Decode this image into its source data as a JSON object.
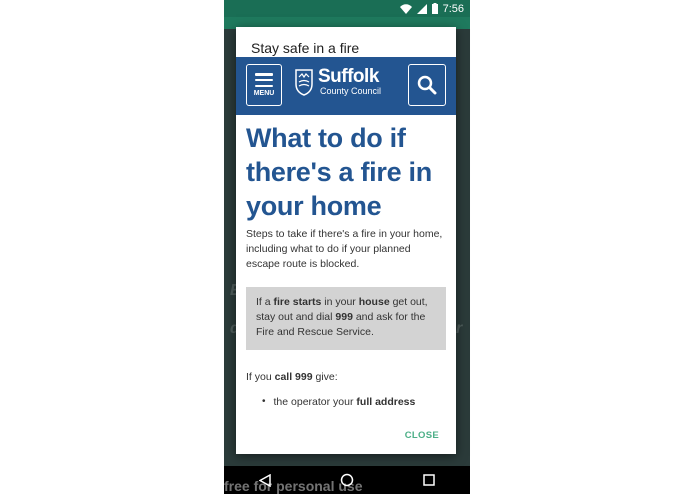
{
  "status": {
    "time": "7:56"
  },
  "background": {
    "text_left": "E",
    "text_right": "r",
    "text_mid_left": "d"
  },
  "dialog": {
    "title": "Stay safe in a fire",
    "close_label": "CLOSE"
  },
  "site": {
    "menu_label": "MENU",
    "logo_name": "Suffolk",
    "logo_sub": "County Council"
  },
  "article": {
    "heading": "What to do if there's a fire in your home",
    "intro": "Steps to take if there's a fire in your home, including what to do if your planned escape route is blocked.",
    "callout": {
      "p1": "If a ",
      "b1": "fire starts",
      "p2": " in your ",
      "b2": "house",
      "p3": " get out, stay out and dial ",
      "b3": "999",
      "p4": " and ask for the Fire and Rescue Service."
    },
    "call_prefix": "If you ",
    "call_bold": "call 999",
    "call_suffix": " give:",
    "bullet_prefix": "the operator your ",
    "bullet_bold": "full address"
  },
  "watermark": "free for personal use",
  "colors": {
    "brand": "#235591",
    "accent": "#4caf87",
    "statusbar": "#1a6e55"
  }
}
